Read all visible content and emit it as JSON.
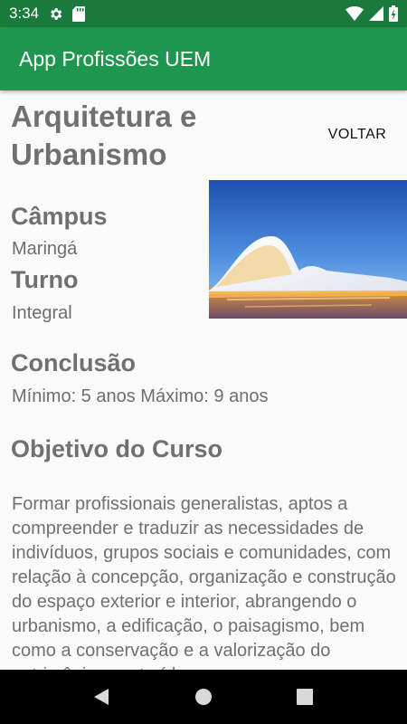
{
  "status_bar": {
    "time": "3:34",
    "icons": [
      "gear-icon",
      "sd-card-icon",
      "wifi-icon",
      "cell-signal-icon",
      "battery-charging-icon"
    ]
  },
  "app_bar": {
    "title": "App Profissões UEM"
  },
  "course": {
    "title": "Arquitetura e Urbanismo",
    "back_label": "VOLTAR",
    "photo": "architecture-photo",
    "campus_label": "Câmpus",
    "campus_value": "Maringá",
    "turno_label": "Turno",
    "turno_value": "Integral",
    "conclusao_label": "Conclusão",
    "conclusao_value": "Mínimo: 5 anos Máximo: 9 anos",
    "objetivo_label": "Objetivo do Curso",
    "objetivo_text": "Formar profissionais generalistas, aptos a compreender e traduzir as necessidades de indivíduos, grupos sociais e comunidades, com relação à concepção, organização e construção do espaço exterior e interior, abrangendo o urbanismo, a edificação, o paisagismo, bem como a conservação e a valorização do patrimônio construído"
  },
  "nav_bar": {
    "buttons": [
      "back-triangle-icon",
      "home-circle-icon",
      "recents-square-icon"
    ]
  },
  "colors": {
    "status_bar": "#1a7a3e",
    "app_bar": "#1e9650",
    "background": "#fafafa",
    "text": "#707070"
  }
}
